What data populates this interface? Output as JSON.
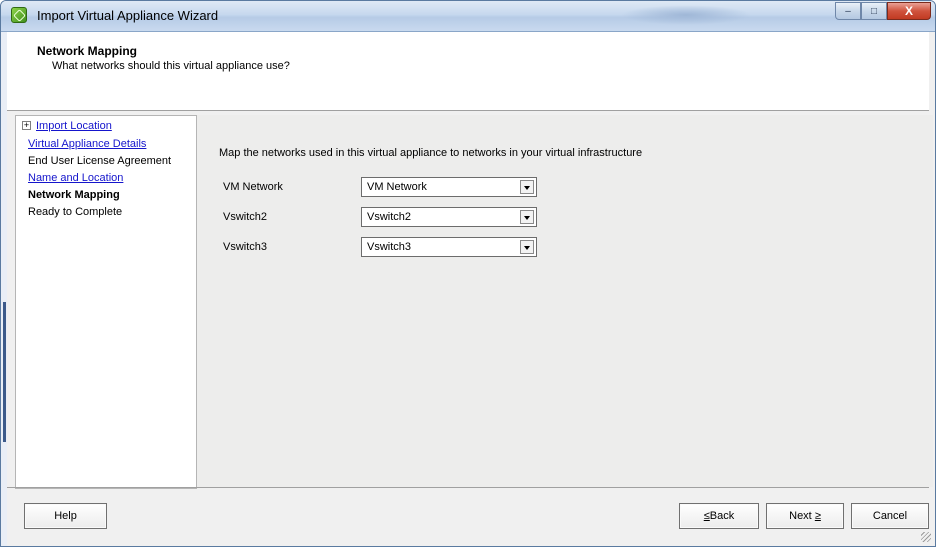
{
  "window": {
    "title": "Import Virtual Appliance Wizard",
    "controls": {
      "minimize": "–",
      "maximize": "□",
      "close": "X"
    }
  },
  "header": {
    "title": "Network Mapping",
    "subtitle": "What networks should this virtual appliance use?"
  },
  "steps": [
    {
      "label": "Import Location",
      "state": "link",
      "expander": "+"
    },
    {
      "label": "Virtual Appliance Details",
      "state": "link"
    },
    {
      "label": "End User License Agreement",
      "state": "normal"
    },
    {
      "label": "Name and Location",
      "state": "link"
    },
    {
      "label": "Network Mapping",
      "state": "current"
    },
    {
      "label": "Ready to Complete",
      "state": "normal"
    }
  ],
  "main": {
    "instruction": "Map the networks used in this virtual appliance to networks in your virtual infrastructure",
    "mappings": [
      {
        "source": "VM Network",
        "destination": "VM Network"
      },
      {
        "source": "Vswitch2",
        "destination": "Vswitch2"
      },
      {
        "source": "Vswitch3",
        "destination": "Vswitch3"
      }
    ]
  },
  "footer": {
    "help": "Help",
    "back_mnemonic": "≤",
    "back_rest": "Back",
    "next_label": "Next ",
    "next_mnemonic": "≥",
    "cancel": "Cancel"
  },
  "colors": {
    "link": "#1515cc",
    "content_bg": "#ededec",
    "titlebar": "#c6d8ee"
  }
}
